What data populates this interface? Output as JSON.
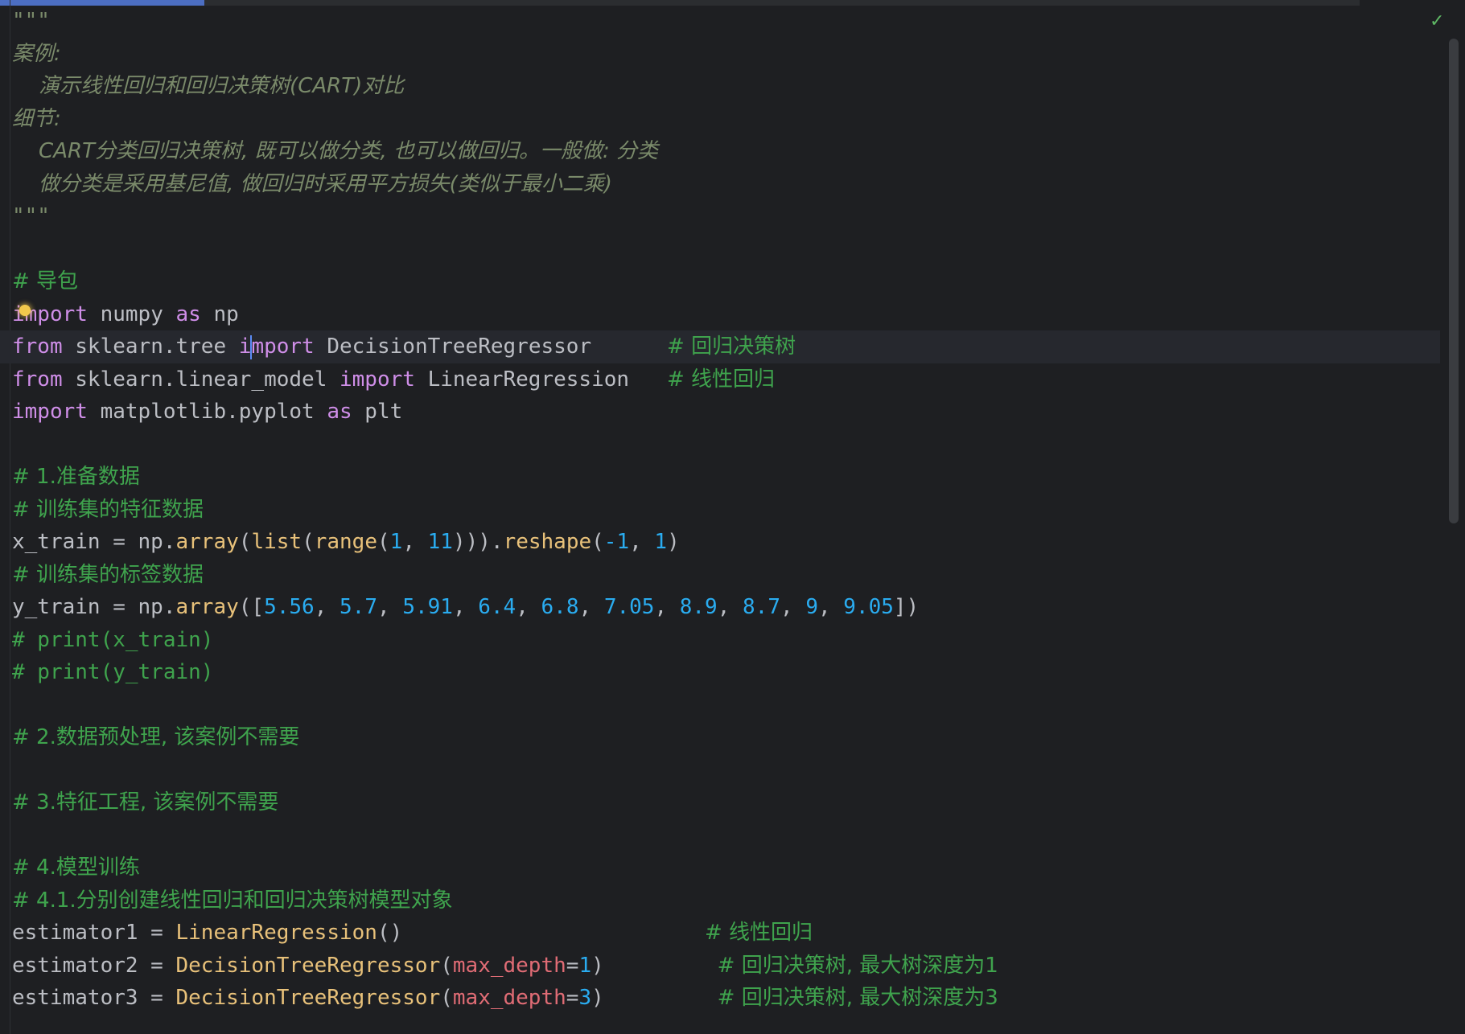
{
  "editor": {
    "status": {
      "inspection_icon": "check-icon",
      "progress_fraction": 0.15
    },
    "scrollbar": {
      "thumb_fraction": 0.49
    },
    "lines": [
      {
        "segments": [
          {
            "t": "\"\"\"",
            "c": "doc"
          }
        ]
      },
      {
        "segments": [
          {
            "t": "案例:",
            "c": "doc"
          }
        ]
      },
      {
        "segments": [
          {
            "t": "    演示线性回归和回归决策树(CART)对比",
            "c": "doc"
          }
        ]
      },
      {
        "segments": [
          {
            "t": "细节:",
            "c": "doc"
          }
        ]
      },
      {
        "segments": [
          {
            "t": "    CART分类回归决策树, 既可以做分类, 也可以做回归。一般做: 分类",
            "c": "doc"
          }
        ]
      },
      {
        "segments": [
          {
            "t": "    做分类是采用基尼值, 做回归时采用平方损失(类似于最小二乘)",
            "c": "doc"
          }
        ]
      },
      {
        "segments": [
          {
            "t": "\"\"\"",
            "c": "doc"
          }
        ]
      },
      {
        "segments": []
      },
      {
        "segments": [
          {
            "t": "# 导包",
            "c": "cmt"
          }
        ]
      },
      {
        "bulb": true,
        "segments": [
          {
            "t": "import",
            "c": "kw"
          },
          {
            "t": " numpy ",
            "c": "id"
          },
          {
            "t": "as",
            "c": "kw"
          },
          {
            "t": " np",
            "c": "id"
          }
        ]
      },
      {
        "current": true,
        "segments": [
          {
            "t": "from",
            "c": "kw"
          },
          {
            "t": " sklearn.tree ",
            "c": "id"
          },
          {
            "t": "i",
            "c": "kw"
          },
          {
            "t": "",
            "c": "caret"
          },
          {
            "t": "mport",
            "c": "kw"
          },
          {
            "t": " DecisionTreeRegressor      ",
            "c": "id"
          },
          {
            "t": "# 回归决策树",
            "c": "cmt"
          }
        ]
      },
      {
        "segments": [
          {
            "t": "from",
            "c": "kw"
          },
          {
            "t": " sklearn.linear_model ",
            "c": "id"
          },
          {
            "t": "import",
            "c": "kw"
          },
          {
            "t": " LinearRegression   ",
            "c": "id"
          },
          {
            "t": "# 线性回归",
            "c": "cmt"
          }
        ]
      },
      {
        "segments": [
          {
            "t": "import",
            "c": "kw"
          },
          {
            "t": " matplotlib.pyplot ",
            "c": "id"
          },
          {
            "t": "as",
            "c": "kw"
          },
          {
            "t": " plt",
            "c": "id"
          }
        ]
      },
      {
        "segments": []
      },
      {
        "segments": [
          {
            "t": "# 1.准备数据",
            "c": "cmt"
          }
        ]
      },
      {
        "segments": [
          {
            "t": "# 训练集的特征数据",
            "c": "cmt"
          }
        ]
      },
      {
        "segments": [
          {
            "t": "x_train = np.",
            "c": "id"
          },
          {
            "t": "array",
            "c": "fn"
          },
          {
            "t": "(",
            "c": "id"
          },
          {
            "t": "list",
            "c": "fn"
          },
          {
            "t": "(",
            "c": "id"
          },
          {
            "t": "range",
            "c": "fn"
          },
          {
            "t": "(",
            "c": "id"
          },
          {
            "t": "1",
            "c": "num"
          },
          {
            "t": ", ",
            "c": "id"
          },
          {
            "t": "11",
            "c": "num"
          },
          {
            "t": "))).",
            "c": "id"
          },
          {
            "t": "reshape",
            "c": "fn"
          },
          {
            "t": "(",
            "c": "id"
          },
          {
            "t": "-1",
            "c": "num"
          },
          {
            "t": ", ",
            "c": "id"
          },
          {
            "t": "1",
            "c": "num"
          },
          {
            "t": ")",
            "c": "id"
          }
        ]
      },
      {
        "segments": [
          {
            "t": "# 训练集的标签数据",
            "c": "cmt"
          }
        ]
      },
      {
        "segments": [
          {
            "t": "y_train = np.",
            "c": "id"
          },
          {
            "t": "array",
            "c": "fn"
          },
          {
            "t": "([",
            "c": "id"
          },
          {
            "t": "5.56",
            "c": "num"
          },
          {
            "t": ", ",
            "c": "id"
          },
          {
            "t": "5.7",
            "c": "num"
          },
          {
            "t": ", ",
            "c": "id"
          },
          {
            "t": "5.91",
            "c": "num"
          },
          {
            "t": ", ",
            "c": "id"
          },
          {
            "t": "6.4",
            "c": "num"
          },
          {
            "t": ", ",
            "c": "id"
          },
          {
            "t": "6.8",
            "c": "num"
          },
          {
            "t": ", ",
            "c": "id"
          },
          {
            "t": "7.05",
            "c": "num"
          },
          {
            "t": ", ",
            "c": "id"
          },
          {
            "t": "8.9",
            "c": "num"
          },
          {
            "t": ", ",
            "c": "id"
          },
          {
            "t": "8.7",
            "c": "num"
          },
          {
            "t": ", ",
            "c": "id"
          },
          {
            "t": "9",
            "c": "num"
          },
          {
            "t": ", ",
            "c": "id"
          },
          {
            "t": "9.05",
            "c": "num"
          },
          {
            "t": "])",
            "c": "id"
          }
        ]
      },
      {
        "segments": [
          {
            "t": "# print(x_train)",
            "c": "cmt"
          }
        ]
      },
      {
        "segments": [
          {
            "t": "# print(y_train)",
            "c": "cmt"
          }
        ]
      },
      {
        "segments": []
      },
      {
        "segments": [
          {
            "t": "# 2.数据预处理, 该案例不需要",
            "c": "cmt"
          }
        ]
      },
      {
        "segments": []
      },
      {
        "segments": [
          {
            "t": "# 3.特征工程, 该案例不需要",
            "c": "cmt"
          }
        ]
      },
      {
        "segments": []
      },
      {
        "segments": [
          {
            "t": "# 4.模型训练",
            "c": "cmt"
          }
        ]
      },
      {
        "segments": [
          {
            "t": "# 4.1.分别创建线性回归和回归决策树模型对象",
            "c": "cmt"
          }
        ]
      },
      {
        "segments": [
          {
            "t": "estimator1 = ",
            "c": "id"
          },
          {
            "t": "LinearRegression",
            "c": "fn"
          },
          {
            "t": "()                        ",
            "c": "id"
          },
          {
            "t": "# 线性回归",
            "c": "cmt"
          }
        ]
      },
      {
        "segments": [
          {
            "t": "estimator2 = ",
            "c": "id"
          },
          {
            "t": "DecisionTreeRegressor",
            "c": "fn"
          },
          {
            "t": "(",
            "c": "id"
          },
          {
            "t": "max_depth",
            "c": "param"
          },
          {
            "t": "=",
            "c": "id"
          },
          {
            "t": "1",
            "c": "num"
          },
          {
            "t": ")         ",
            "c": "id"
          },
          {
            "t": "# 回归决策树, 最大树深度为1",
            "c": "cmt"
          }
        ]
      },
      {
        "segments": [
          {
            "t": "estimator3 = ",
            "c": "id"
          },
          {
            "t": "DecisionTreeRegressor",
            "c": "fn"
          },
          {
            "t": "(",
            "c": "id"
          },
          {
            "t": "max_depth",
            "c": "param"
          },
          {
            "t": "=",
            "c": "id"
          },
          {
            "t": "3",
            "c": "num"
          },
          {
            "t": ")         ",
            "c": "id"
          },
          {
            "t": "# 回归决策树, 最大树深度为3",
            "c": "cmt"
          }
        ]
      }
    ]
  }
}
